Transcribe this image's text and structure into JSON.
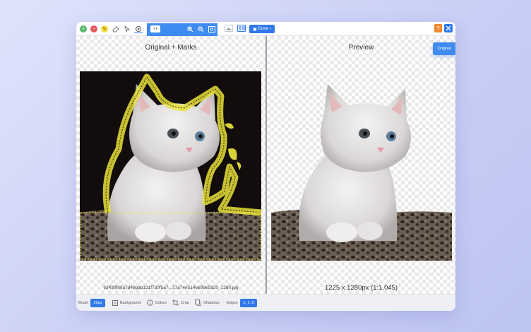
{
  "toolbar": {
    "zoom_value": "1",
    "done_label": "Done",
    "help_label": "?"
  },
  "panes": {
    "left_title": "Original + Marks",
    "right_title": "Preview",
    "original_button": "Original",
    "filename": "6343f980a7d49gab131f730f5a7...17a74e514e699e5920_1280.jpg",
    "dimensions": "1225 x 1280px (1:1.045)"
  },
  "bottombar": {
    "brush_label": "Brush",
    "brush_size": "20px",
    "background_label": "Background",
    "colors_label": "Colors",
    "crop_label": "Crop",
    "shadows_label": "Shadows",
    "edges_label": "Edges",
    "edges_value": "1, 1, 0"
  },
  "colors": {
    "accent": "#3178e8",
    "toolbar_blue": "#3f8cf0",
    "help_orange": "#f0882c",
    "keep_marker": "#59b86a",
    "remove_marker": "#e55a5a",
    "highlight": "#e9e23a"
  }
}
